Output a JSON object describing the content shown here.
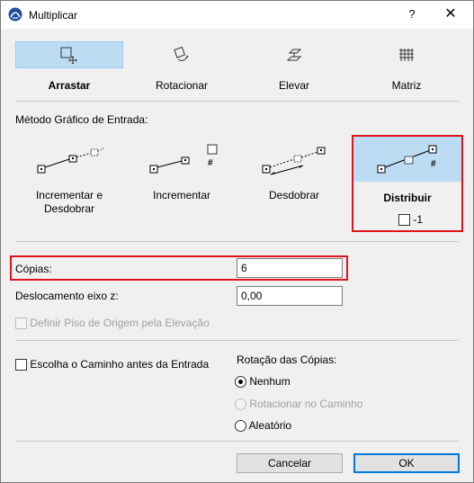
{
  "window": {
    "title": "Multiplicar",
    "help": "?",
    "close": "✕"
  },
  "modes": [
    {
      "label": "Arrastar",
      "icon": "drag-icon"
    },
    {
      "label": "Rotacionar",
      "icon": "rotate-icon"
    },
    {
      "label": "Elevar",
      "icon": "elevate-icon"
    },
    {
      "label": "Matriz",
      "icon": "matrix-icon"
    }
  ],
  "method_section": {
    "label": "Método Gráfico de Entrada:",
    "options": [
      {
        "label_line1": "Incrementar e",
        "label_line2": "Desdobrar"
      },
      {
        "label_line1": "Incrementar",
        "label_line2": ""
      },
      {
        "label_line1": "Desdobrar",
        "label_line2": ""
      },
      {
        "label_line1": "Distribuir",
        "label_line2": ""
      }
    ],
    "distribute_option": {
      "label": "-1",
      "checked": false
    }
  },
  "copies": {
    "label": "Cópias:",
    "value": "6"
  },
  "z_offset": {
    "label": "Deslocamento eixo z:",
    "value": "0,00"
  },
  "origin_floor": {
    "label": "Definir Piso de Origem pela Elevação",
    "enabled": false
  },
  "path_first": {
    "label": "Escolha o Caminho antes da Entrada",
    "checked": false
  },
  "rotation": {
    "label": "Rotação das Cópias:",
    "options": [
      {
        "label": "Nenhum",
        "checked": true,
        "enabled": true
      },
      {
        "label": "Rotacionar no Caminho",
        "checked": false,
        "enabled": false
      },
      {
        "label": "Aleatório",
        "checked": false,
        "enabled": true
      }
    ]
  },
  "buttons": {
    "cancel": "Cancelar",
    "ok": "OK"
  },
  "colors": {
    "selected": "#bcdcf4",
    "highlight": "#e0151b",
    "default_border": "#0078d7"
  }
}
